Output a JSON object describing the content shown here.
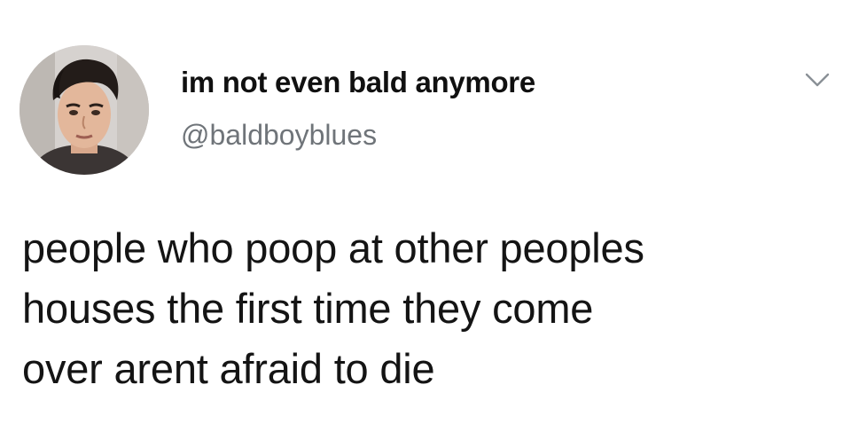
{
  "tweet": {
    "author": {
      "display_name": "im not even bald anymore",
      "handle": "@baldboyblues",
      "avatar": "profile-photo"
    },
    "menu_icon": "chevron-down-icon",
    "text_lines": [
      "people who poop at other peoples",
      "houses the first time they come",
      "over arent afraid to die"
    ]
  }
}
